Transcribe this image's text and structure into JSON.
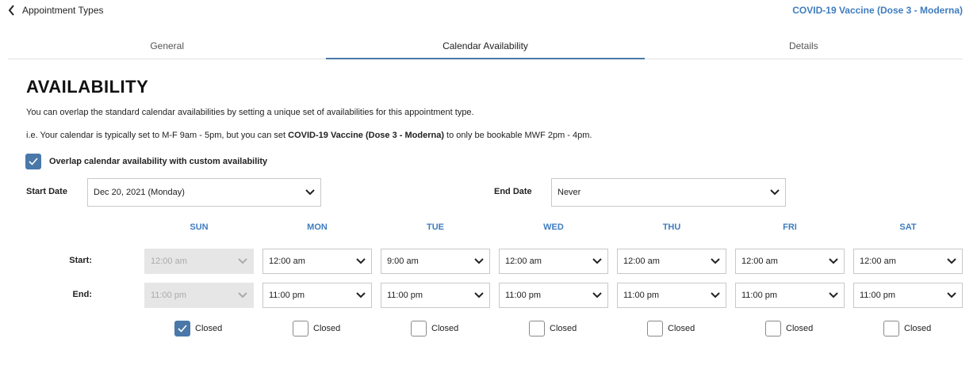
{
  "nav": {
    "back_label": "Appointment Types",
    "appointment_name": "COVID-19 Vaccine (Dose 3 - Moderna)"
  },
  "tabs": [
    {
      "label": "General",
      "active": false
    },
    {
      "label": "Calendar Availability",
      "active": true
    },
    {
      "label": "Details",
      "active": false
    }
  ],
  "availability": {
    "heading": "AVAILABILITY",
    "description_1": "You can overlap the standard calendar availabilities by setting a unique set of availabilities for this appointment type.",
    "description_2_prefix": "i.e. Your calendar is typically set to M-F 9am - 5pm, but you can set ",
    "description_2_bold": "COVID-19 Vaccine (Dose 3 - Moderna)",
    "description_2_suffix": " to only be bookable MWF 2pm - 4pm.",
    "overlap_checkbox": {
      "label": "Overlap calendar availability with custom availability",
      "checked": true
    },
    "start_date": {
      "label": "Start Date",
      "value": "Dec 20, 2021 (Monday)"
    },
    "end_date": {
      "label": "End Date",
      "value": "Never"
    },
    "row_labels": {
      "start": "Start:",
      "end": "End:"
    },
    "days": [
      {
        "name": "SUN",
        "start": "12:00 am",
        "end": "11:00 pm",
        "closed_label": "Closed",
        "closed": true
      },
      {
        "name": "MON",
        "start": "12:00 am",
        "end": "11:00 pm",
        "closed_label": "Closed",
        "closed": false
      },
      {
        "name": "TUE",
        "start": "9:00 am",
        "end": "11:00 pm",
        "closed_label": "Closed",
        "closed": false
      },
      {
        "name": "WED",
        "start": "12:00 am",
        "end": "11:00 pm",
        "closed_label": "Closed",
        "closed": false
      },
      {
        "name": "THU",
        "start": "12:00 am",
        "end": "11:00 pm",
        "closed_label": "Closed",
        "closed": false
      },
      {
        "name": "FRI",
        "start": "12:00 am",
        "end": "11:00 pm",
        "closed_label": "Closed",
        "closed": false
      },
      {
        "name": "SAT",
        "start": "12:00 am",
        "end": "11:00 pm",
        "closed_label": "Closed",
        "closed": false
      }
    ]
  },
  "colors": {
    "accent": "#4a78a8",
    "link": "#3f7cbf",
    "disabled_bg": "#e6e6e6"
  },
  "icons": {
    "back": "chevron-left-icon",
    "dropdown": "chevron-down-icon",
    "check": "check-icon"
  }
}
